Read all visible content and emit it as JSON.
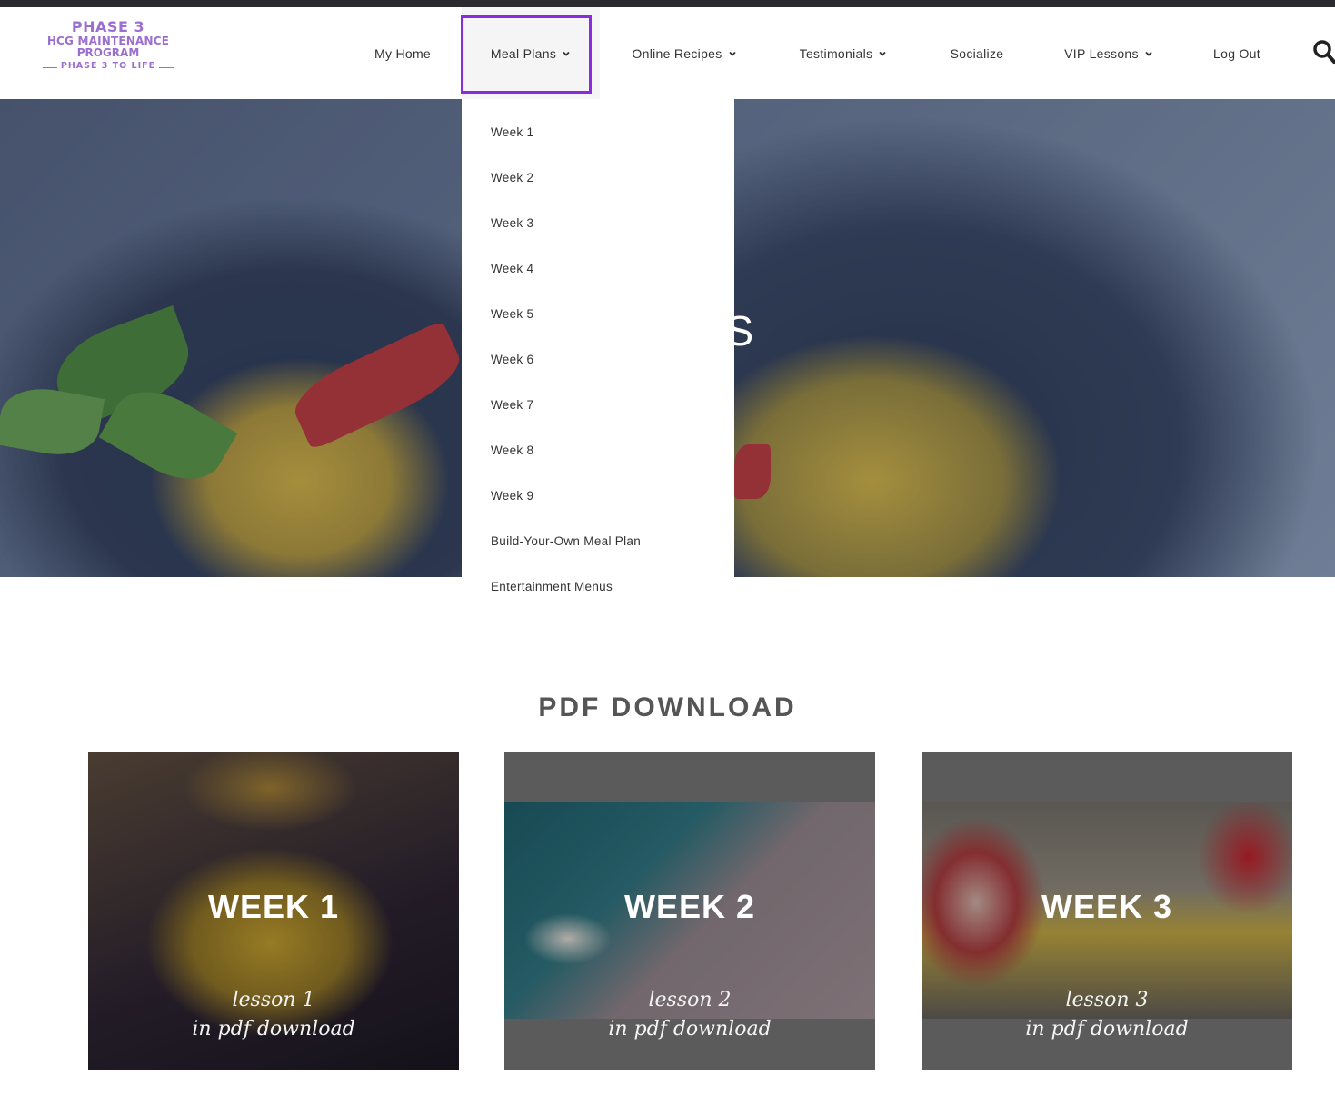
{
  "logo": {
    "line1": "PHASE 3",
    "line2": "HCG MAINTENANCE",
    "line3": "PROGRAM",
    "line4": "PHASE 3 TO LIFE"
  },
  "nav": {
    "items": [
      {
        "label": "My Home",
        "has_dropdown": false
      },
      {
        "label": "Meal Plans",
        "has_dropdown": true
      },
      {
        "label": "Online Recipes",
        "has_dropdown": true
      },
      {
        "label": "Testimonials",
        "has_dropdown": true
      },
      {
        "label": "Socialize",
        "has_dropdown": false
      },
      {
        "label": "VIP Lessons",
        "has_dropdown": true
      },
      {
        "label": "Log Out",
        "has_dropdown": false
      }
    ],
    "active": "Meal Plans",
    "highlight_color": "#8a2be2",
    "search_icon": "search-icon"
  },
  "hero": {
    "title_visible": "LANS"
  },
  "dropdown": {
    "items": [
      "Week 1",
      "Week 2",
      "Week 3",
      "Week 4",
      "Week 5",
      "Week 6",
      "Week 7",
      "Week 8",
      "Week 9",
      "Build-Your-Own Meal Plan",
      "Entertainment Menus"
    ]
  },
  "pdf_section": {
    "title": "PDF DOWNLOAD",
    "cards": [
      {
        "week": "WEEK 1",
        "lesson_line1": "lesson 1",
        "lesson_line2": "in pdf download"
      },
      {
        "week": "WEEK 2",
        "lesson_line1": "lesson 2",
        "lesson_line2": "in pdf download"
      },
      {
        "week": "WEEK 3",
        "lesson_line1": "lesson 3",
        "lesson_line2": "in pdf download"
      }
    ]
  },
  "colors": {
    "brand_purple": "#9b6fd0",
    "text": "#333333",
    "section_title": "#555555"
  }
}
